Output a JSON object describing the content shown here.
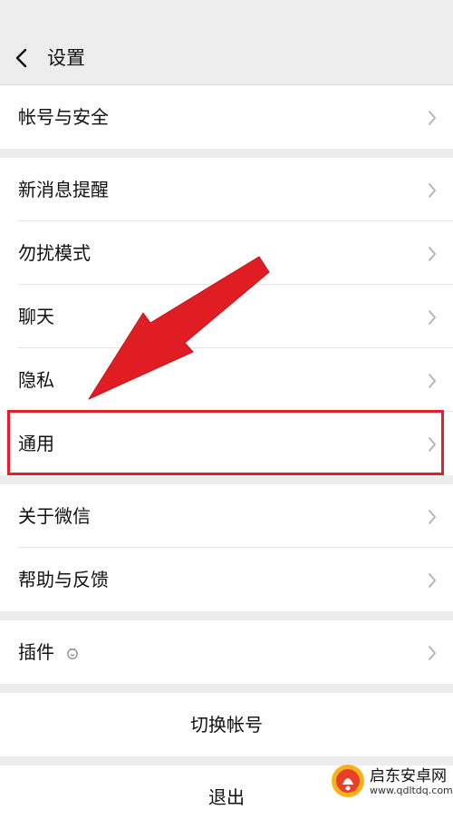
{
  "header": {
    "title": "设置"
  },
  "groups": {
    "account": {
      "account_security": "帐号与安全"
    },
    "main": {
      "notifications": "新消息提醒",
      "dnd": "勿扰模式",
      "chat": "聊天",
      "privacy": "隐私",
      "general": "通用"
    },
    "about": {
      "about_wechat": "关于微信",
      "help_feedback": "帮助与反馈"
    },
    "plugins": {
      "plugins": "插件"
    }
  },
  "actions": {
    "switch_account": "切换帐号",
    "logout": "退出"
  },
  "watermark": {
    "title": "启东安卓网",
    "url": "www.qdltdq.com"
  },
  "colors": {
    "background": "#ededed",
    "highlight": "#e0202a",
    "text": "#111111"
  }
}
